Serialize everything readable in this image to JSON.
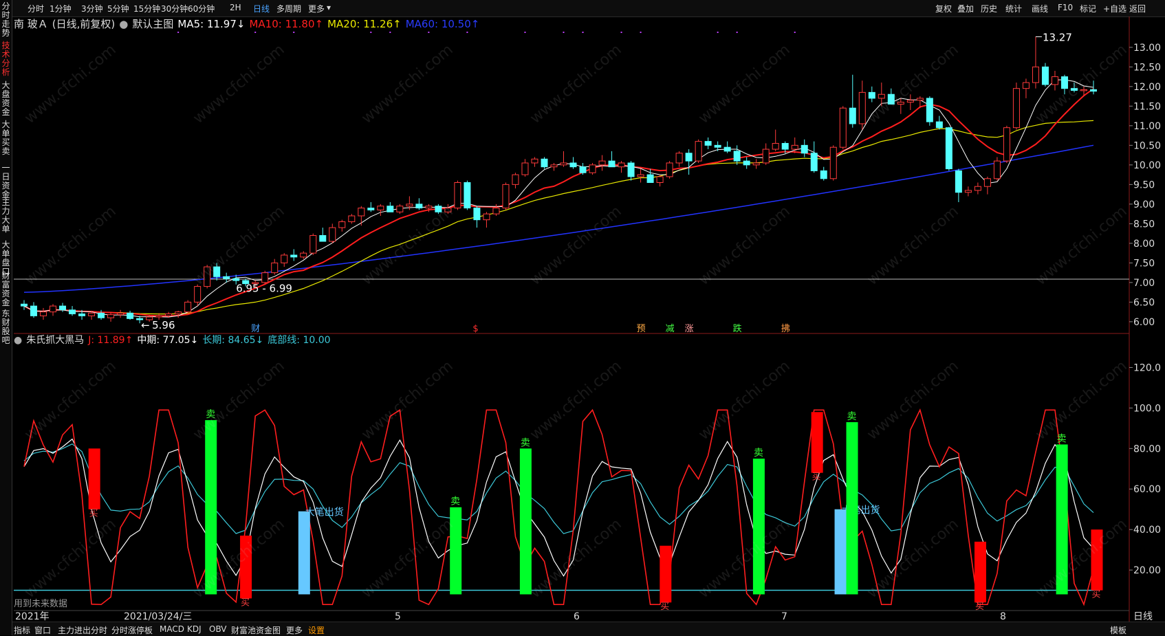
{
  "sidebar": {
    "items": [
      {
        "label": "分时走势",
        "active": false
      },
      {
        "label": "技术分析",
        "active": true
      },
      {
        "label": "大盘资金",
        "active": false
      },
      {
        "label": "大单买卖",
        "active": false
      },
      {
        "label": "一日资金",
        "active": false
      },
      {
        "label": "主力大单",
        "active": false
      },
      {
        "label": "大单盘口",
        "active": false
      },
      {
        "label": "财富资金",
        "active": false
      },
      {
        "label": "东财股吧",
        "active": false
      }
    ]
  },
  "toolbar": {
    "periods": [
      "分时",
      "1分钟",
      "3分钟",
      "5分钟",
      "15分钟",
      "30分钟",
      "60分钟",
      "2H",
      "日线",
      "多周期",
      "更多"
    ],
    "active_period": "日线",
    "more_arrow": "▾",
    "right_items": [
      "复权",
      "叠加",
      "历史",
      "统计",
      "画线",
      "F10",
      "标记",
      "+自选",
      "返回"
    ]
  },
  "main_info": {
    "stock_name": "南 玻Ａ",
    "mode": "(日线,前复权)",
    "template": "默认主图",
    "ma5": "MA5: 11.97↓",
    "ma10": "MA10: 11.80↑",
    "ma20": "MA20: 11.26↑",
    "ma60": "MA60: 10.50↑"
  },
  "indicator_info": {
    "name": "朱氏抓大黑马",
    "j": "J: 11.89↑",
    "mid": "中期: 77.05↓",
    "long": "长期: 84.65↓",
    "bottom": "底部线: 10.00"
  },
  "colors": {
    "up": "#ff3b3b",
    "down": "#54ffff",
    "ma5": "#ffffff",
    "ma10": "#ff1e1e",
    "ma20": "#e8e800",
    "ma60": "#2233ff",
    "green_bar": "#00ff2a",
    "red_bar": "#ff0000",
    "blue_bar": "#66c8ff",
    "axis_text": "#dddddd",
    "grid_border": "#8b1a1a"
  },
  "price_axis": {
    "labels": [
      "13.00",
      "12.50",
      "12.00",
      "11.50",
      "11.00",
      "10.50",
      "10.00",
      "9.50",
      "9.00",
      "8.50",
      "8.00",
      "7.50",
      "7.00",
      "6.50",
      "6.00"
    ],
    "min": 5.7,
    "max": 13.4
  },
  "indicator_axis": {
    "labels": [
      "120.0",
      "100.0",
      "80.00",
      "60.00",
      "40.00",
      "20.00"
    ],
    "min": 0,
    "max": 130
  },
  "annotations": {
    "high": "13.27",
    "low": "5.96",
    "range": "6.95 - 6.99",
    "event_icons": [
      "财",
      "$",
      "预",
      "减",
      "涨",
      "跌",
      "拂"
    ],
    "sell": "卖",
    "buy": "买",
    "big_sell": "大笔出货",
    "future_data": "用到未来数据"
  },
  "date_axis": {
    "labels": [
      "2021年",
      "2021/03/24/三",
      "5",
      "6",
      "7",
      "8"
    ],
    "period_label": "日线"
  },
  "bottom_tabs": {
    "items": [
      "指标",
      "窗口",
      "主力进出分时",
      "分时涨停板",
      "MACD",
      "KDJ",
      "OBV",
      "财富池资金图",
      "更多",
      "设置"
    ],
    "active": "设置",
    "right_label": "模板"
  },
  "watermark": "www.cfchi.com",
  "chart_data": {
    "type": "candlestick",
    "ohlc": [
      [
        6.45,
        6.55,
        6.3,
        6.4
      ],
      [
        6.4,
        6.5,
        6.1,
        6.15
      ],
      [
        6.15,
        6.35,
        6.05,
        6.25
      ],
      [
        6.25,
        6.45,
        6.15,
        6.4
      ],
      [
        6.4,
        6.48,
        6.25,
        6.3
      ],
      [
        6.3,
        6.4,
        6.15,
        6.2
      ],
      [
        6.2,
        6.3,
        6.05,
        6.15
      ],
      [
        6.15,
        6.28,
        6.05,
        6.22
      ],
      [
        6.22,
        6.3,
        6.05,
        6.1
      ],
      [
        6.1,
        6.25,
        6.0,
        6.18
      ],
      [
        6.18,
        6.3,
        6.1,
        6.22
      ],
      [
        6.22,
        6.28,
        6.05,
        6.08
      ],
      [
        6.08,
        6.15,
        5.96,
        6.05
      ],
      [
        6.05,
        6.18,
        6.0,
        6.12
      ],
      [
        6.12,
        6.22,
        6.05,
        6.15
      ],
      [
        6.15,
        6.25,
        6.1,
        6.2
      ],
      [
        6.2,
        6.28,
        6.1,
        6.25
      ],
      [
        6.25,
        6.55,
        6.2,
        6.5
      ],
      [
        6.5,
        6.95,
        6.4,
        6.9
      ],
      [
        6.9,
        7.45,
        6.85,
        7.4
      ],
      [
        7.4,
        7.5,
        7.05,
        7.15
      ],
      [
        7.15,
        7.25,
        7.0,
        7.1
      ],
      [
        7.1,
        7.2,
        6.95,
        7.05
      ],
      [
        7.05,
        7.1,
        6.9,
        6.97
      ],
      [
        6.97,
        7.05,
        6.9,
        7.0
      ],
      [
        7.0,
        7.3,
        6.95,
        7.25
      ],
      [
        7.25,
        7.6,
        7.2,
        7.5
      ],
      [
        7.5,
        7.75,
        7.4,
        7.7
      ],
      [
        7.7,
        7.85,
        7.55,
        7.65
      ],
      [
        7.65,
        7.8,
        7.6,
        7.75
      ],
      [
        7.75,
        8.25,
        7.7,
        8.2
      ],
      [
        8.2,
        8.4,
        8.1,
        8.05
      ],
      [
        8.05,
        8.5,
        8.0,
        8.4
      ],
      [
        8.4,
        8.6,
        8.3,
        8.55
      ],
      [
        8.55,
        8.75,
        8.5,
        8.7
      ],
      [
        8.7,
        8.95,
        8.45,
        8.9
      ],
      [
        8.9,
        9.05,
        8.8,
        8.85
      ],
      [
        8.85,
        9.0,
        8.7,
        8.95
      ],
      [
        8.95,
        9.05,
        8.8,
        8.8
      ],
      [
        8.8,
        9.0,
        8.75,
        8.95
      ],
      [
        8.95,
        9.2,
        8.85,
        9.0
      ],
      [
        9.0,
        9.15,
        8.85,
        8.9
      ],
      [
        8.9,
        9.0,
        8.8,
        8.95
      ],
      [
        8.95,
        9.0,
        8.75,
        8.8
      ],
      [
        8.8,
        9.0,
        8.75,
        8.9
      ],
      [
        8.9,
        9.6,
        8.85,
        9.55
      ],
      [
        9.55,
        9.6,
        8.85,
        8.9
      ],
      [
        8.9,
        8.95,
        8.4,
        8.6
      ],
      [
        8.6,
        8.8,
        8.4,
        8.75
      ],
      [
        8.75,
        9.0,
        8.7,
        8.9
      ],
      [
        8.9,
        9.55,
        8.85,
        9.5
      ],
      [
        9.5,
        9.8,
        9.4,
        9.75
      ],
      [
        9.75,
        10.15,
        9.7,
        10.05
      ],
      [
        10.05,
        10.2,
        9.95,
        10.15
      ],
      [
        10.15,
        10.2,
        9.9,
        9.95
      ],
      [
        9.95,
        10.05,
        9.85,
        10.0
      ],
      [
        10.0,
        10.35,
        9.95,
        10.05
      ],
      [
        10.05,
        10.2,
        9.9,
        9.95
      ],
      [
        9.95,
        10.05,
        9.75,
        9.8
      ],
      [
        9.8,
        10.05,
        9.75,
        10.0
      ],
      [
        10.0,
        10.25,
        9.85,
        10.1
      ],
      [
        10.1,
        10.35,
        9.95,
        9.95
      ],
      [
        9.95,
        10.1,
        9.8,
        10.05
      ],
      [
        10.05,
        10.1,
        9.6,
        9.7
      ],
      [
        9.7,
        9.9,
        9.55,
        9.75
      ],
      [
        9.75,
        9.9,
        9.6,
        9.55
      ],
      [
        9.55,
        9.75,
        9.45,
        9.7
      ],
      [
        9.7,
        10.1,
        9.65,
        10.05
      ],
      [
        10.05,
        10.35,
        9.95,
        10.3
      ],
      [
        10.3,
        10.4,
        9.75,
        10.1
      ],
      [
        10.1,
        10.65,
        10.05,
        10.6
      ],
      [
        10.6,
        10.7,
        10.4,
        10.5
      ],
      [
        10.5,
        10.6,
        10.35,
        10.45
      ],
      [
        10.45,
        10.6,
        10.3,
        10.35
      ],
      [
        10.35,
        10.5,
        10.0,
        10.1
      ],
      [
        10.1,
        10.2,
        9.9,
        10.0
      ],
      [
        10.0,
        10.15,
        9.9,
        10.05
      ],
      [
        10.05,
        10.55,
        10.0,
        10.4
      ],
      [
        10.4,
        10.9,
        10.35,
        10.55
      ],
      [
        10.55,
        10.6,
        10.3,
        10.4
      ],
      [
        10.4,
        10.7,
        10.3,
        10.5
      ],
      [
        10.5,
        10.65,
        10.2,
        10.3
      ],
      [
        10.3,
        10.6,
        9.8,
        9.85
      ],
      [
        9.85,
        9.95,
        9.6,
        9.65
      ],
      [
        9.65,
        10.5,
        9.6,
        10.45
      ],
      [
        10.45,
        11.5,
        10.4,
        11.45
      ],
      [
        11.45,
        12.3,
        10.95,
        11.05
      ],
      [
        11.05,
        12.15,
        10.9,
        11.85
      ],
      [
        11.85,
        12.0,
        11.6,
        11.7
      ],
      [
        11.7,
        12.1,
        11.5,
        11.8
      ],
      [
        11.8,
        11.95,
        11.6,
        11.55
      ],
      [
        11.55,
        11.7,
        11.3,
        11.6
      ],
      [
        11.6,
        11.8,
        11.4,
        11.65
      ],
      [
        11.65,
        11.75,
        11.45,
        11.7
      ],
      [
        11.7,
        11.75,
        11.0,
        11.1
      ],
      [
        11.1,
        11.25,
        10.9,
        10.95
      ],
      [
        10.95,
        10.97,
        9.85,
        9.9
      ],
      [
        9.85,
        9.9,
        9.05,
        9.3
      ],
      [
        9.3,
        9.45,
        9.2,
        9.35
      ],
      [
        9.35,
        9.55,
        9.25,
        9.45
      ],
      [
        9.45,
        9.7,
        9.25,
        9.65
      ],
      [
        9.65,
        10.2,
        9.6,
        10.1
      ],
      [
        10.1,
        11.0,
        10.05,
        10.95
      ],
      [
        10.95,
        12.1,
        10.9,
        11.95
      ],
      [
        11.95,
        12.2,
        11.7,
        12.1
      ],
      [
        12.1,
        13.27,
        11.95,
        12.5
      ],
      [
        12.5,
        12.6,
        12.0,
        12.05
      ],
      [
        12.05,
        12.4,
        11.9,
        12.25
      ],
      [
        12.25,
        12.3,
        11.8,
        11.95
      ],
      [
        11.95,
        12.1,
        11.85,
        11.9
      ],
      [
        11.9,
        12.0,
        11.75,
        11.92
      ],
      [
        11.92,
        12.15,
        11.8,
        11.88
      ]
    ],
    "ma60_start": 6.75,
    "ma60_end": 10.5,
    "indicator_series": [
      {
        "name": "J",
        "color": "#ff1e1e"
      },
      {
        "name": "中期",
        "color": "#ffffff"
      },
      {
        "name": "长期",
        "color": "#3cc8d8"
      },
      {
        "name": "底部线",
        "color": "#3cc8d8",
        "value": 10
      }
    ],
    "signal_bars": [
      {
        "i": 6,
        "from": 50,
        "to": 80,
        "color": "red"
      },
      {
        "i": 16,
        "from": 8,
        "to": 94,
        "color": "green"
      },
      {
        "i": 19,
        "from": 6,
        "to": 37,
        "color": "red"
      },
      {
        "i": 24,
        "from": 8,
        "to": 49,
        "color": "blue"
      },
      {
        "i": 37,
        "from": 8,
        "to": 51,
        "color": "green"
      },
      {
        "i": 43,
        "from": 8,
        "to": 80,
        "color": "green"
      },
      {
        "i": 55,
        "from": 4,
        "to": 32,
        "color": "red"
      },
      {
        "i": 63,
        "from": 8,
        "to": 75,
        "color": "green"
      },
      {
        "i": 68,
        "from": 68,
        "to": 98,
        "color": "red"
      },
      {
        "i": 70,
        "from": 8,
        "to": 50,
        "color": "blue"
      },
      {
        "i": 71,
        "from": 8,
        "to": 93,
        "color": "green"
      },
      {
        "i": 82,
        "from": 4,
        "to": 34,
        "color": "red"
      },
      {
        "i": 89,
        "from": 8,
        "to": 82,
        "color": "green"
      },
      {
        "i": 92,
        "from": 10,
        "to": 40,
        "color": "red"
      }
    ],
    "y_range_price": [
      5.7,
      13.4
    ],
    "y_range_indicator": [
      0,
      130
    ]
  }
}
